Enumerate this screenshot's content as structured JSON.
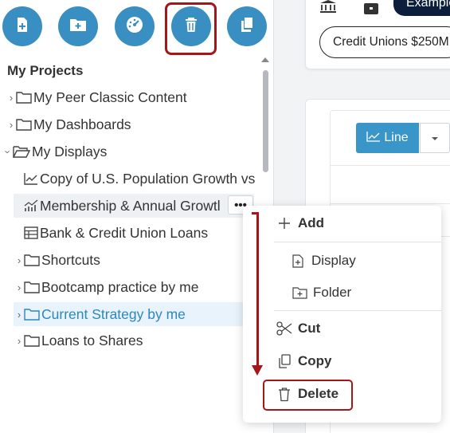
{
  "toolbar": {
    "buttons": [
      {
        "name": "new-display-button",
        "icon": "new-file-icon"
      },
      {
        "name": "new-folder-button",
        "icon": "new-folder-icon"
      },
      {
        "name": "dashboard-button",
        "icon": "gauge-icon"
      },
      {
        "name": "delete-button",
        "icon": "trash-icon",
        "highlighted": true
      },
      {
        "name": "copy-button",
        "icon": "copy-icon"
      }
    ]
  },
  "sidebar": {
    "title": "My Projects",
    "items": [
      {
        "label": "My Peer Classic Content",
        "type": "folder",
        "expandable": true
      },
      {
        "label": "My Dashboards",
        "type": "folder",
        "expandable": true
      },
      {
        "label": "My Displays",
        "type": "folder-open",
        "expanded": true
      },
      {
        "label": "Copy of U.S. Population Growth vs",
        "type": "line-chart"
      },
      {
        "label": "Membership & Annual Growtl",
        "type": "bar-line-chart",
        "hover": true
      },
      {
        "label": "Bank & Credit Union Loans",
        "type": "table"
      },
      {
        "label": "Shortcuts",
        "type": "folder",
        "expandable": true
      },
      {
        "label": "Bootcamp practice by me",
        "type": "folder",
        "expandable": true
      },
      {
        "label": "Current Strategy by me",
        "type": "folder",
        "expandable": true,
        "selected": true
      },
      {
        "label": "Loans to Shares",
        "type": "folder",
        "expandable": true
      }
    ],
    "more_button": "•••"
  },
  "header": {
    "example_label": "Example",
    "filter_pill": "Credit Unions $250M"
  },
  "display": {
    "line_button": "Line"
  },
  "context_menu": {
    "add": "Add",
    "display": "Display",
    "folder": "Folder",
    "cut": "Cut",
    "copy": "Copy",
    "delete": "Delete"
  },
  "colors": {
    "accent": "#3a8fc2",
    "highlight": "#a4161a",
    "selected_text": "#2c86bf",
    "dark_pill": "#0c1e3c"
  }
}
